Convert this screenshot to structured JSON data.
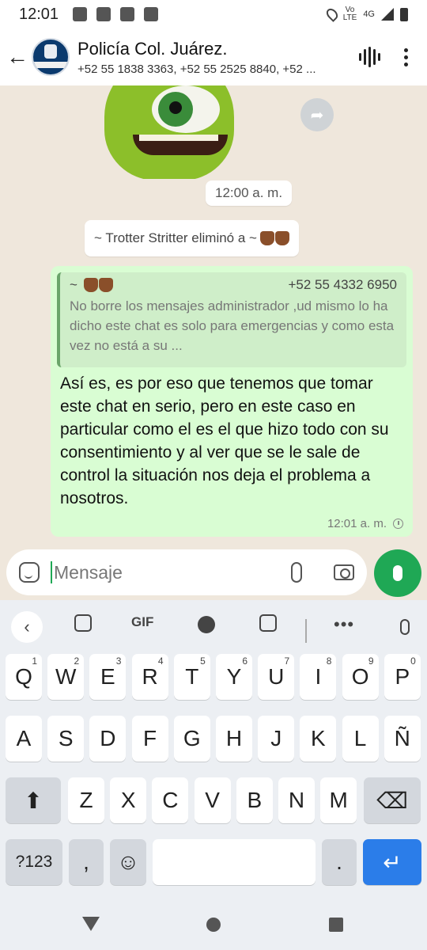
{
  "status_bar": {
    "time": "12:01",
    "network": "4G",
    "carrier_line1": "Vo",
    "carrier_line2": "LTE"
  },
  "header": {
    "title": "Policía Col. Juárez.",
    "subtitle": "+52 55 1838 3363, +52 55 2525 8840, +52 ..."
  },
  "chat": {
    "sticker_time": "12:00 a. m.",
    "system_message": "~ Trotter Stritter eliminó a ~",
    "reply": {
      "quoted_author": "~",
      "quoted_phone": "+52 55 4332 6950",
      "quoted_text": "No borre los mensajes administrador ,ud mismo lo ha dicho este chat es solo para emergencias y  como esta vez no está a su ...",
      "text": "Así es, es por eso que tenemos que tomar este chat en serio, pero en este caso en particular como el es el que hizo todo con su consentimiento y al ver que se le sale de control la situación nos deja el problema a nosotros.",
      "time": "12:01 a. m."
    }
  },
  "composer": {
    "placeholder": "Mensaje"
  },
  "keyboard": {
    "toolbar": {
      "gif": "GIF",
      "more": "•••"
    },
    "row1": [
      {
        "k": "Q",
        "h": "1"
      },
      {
        "k": "W",
        "h": "2"
      },
      {
        "k": "E",
        "h": "3"
      },
      {
        "k": "R",
        "h": "4"
      },
      {
        "k": "T",
        "h": "5"
      },
      {
        "k": "Y",
        "h": "6"
      },
      {
        "k": "U",
        "h": "7"
      },
      {
        "k": "I",
        "h": "8"
      },
      {
        "k": "O",
        "h": "9"
      },
      {
        "k": "P",
        "h": "0"
      }
    ],
    "row2": [
      "A",
      "S",
      "D",
      "F",
      "G",
      "H",
      "J",
      "K",
      "L",
      "Ñ"
    ],
    "row3": [
      "Z",
      "X",
      "C",
      "V",
      "B",
      "N",
      "M"
    ],
    "symbols": "?123",
    "comma": ",",
    "period": ".",
    "enter_icon": "↵",
    "shift_icon": "⬆",
    "backspace_icon": "⌫",
    "emoji_icon": "☺"
  },
  "colors": {
    "accent_green": "#1fa855",
    "bubble_out": "#d9fdd3",
    "enter_key": "#2b7de9"
  }
}
